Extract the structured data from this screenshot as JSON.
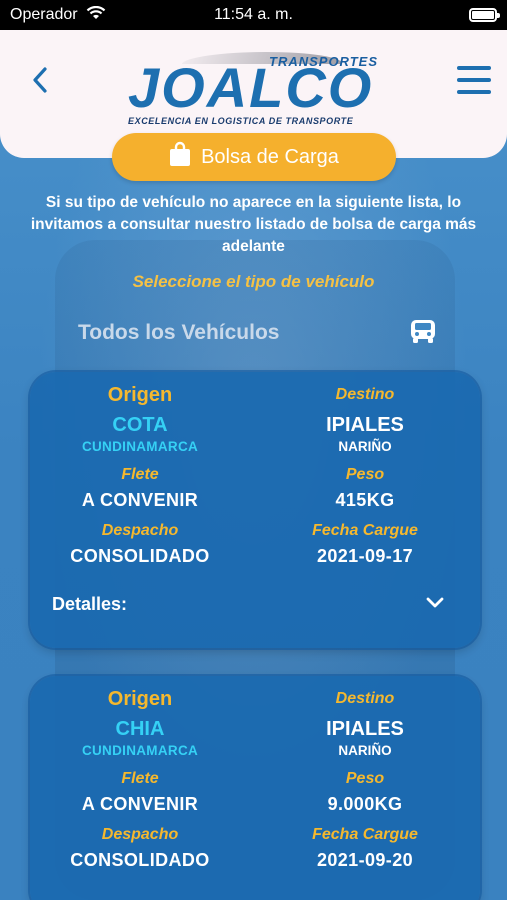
{
  "status_bar": {
    "carrier": "Operador",
    "time": "11:54 a. m."
  },
  "header": {
    "logo": {
      "top": "TRANSPORTES",
      "main": "JOALCO",
      "subtitle": "EXCELENCIA EN LOGISTICA DE TRANSPORTE"
    }
  },
  "bolsa_button": {
    "label": "Bolsa de Carga"
  },
  "intro_text": "Si su tipo de vehículo no aparece en la siguiente lista, lo invitamos a consultar nuestro listado de bolsa de carga más adelante",
  "select_label": "Seleccione el tipo de vehículo",
  "vehicle_select": {
    "value": "Todos los Vehículos"
  },
  "labels": {
    "origen": "Origen",
    "destino": "Destino",
    "flete": "Flete",
    "peso": "Peso",
    "despacho": "Despacho",
    "fecha_cargue": "Fecha Cargue",
    "detalles": "Detalles:"
  },
  "cards": [
    {
      "origen_ciudad": "COTA",
      "origen_depto": "CUNDINAMARCA",
      "destino_ciudad": "IPIALES",
      "destino_depto": "NARIÑO",
      "flete": "A CONVENIR",
      "peso": "415KG",
      "despacho": "CONSOLIDADO",
      "fecha_cargue": "2021-09-17"
    },
    {
      "origen_ciudad": "CHIA",
      "origen_depto": "CUNDINAMARCA",
      "destino_ciudad": "IPIALES",
      "destino_depto": "NARIÑO",
      "flete": "A CONVENIR",
      "peso": "9.000KG",
      "despacho": "CONSOLIDADO",
      "fecha_cargue": "2021-09-20"
    }
  ],
  "colors": {
    "background": "#3f88c4",
    "accent_yellow": "#f5b02d",
    "card": "#1a69b0",
    "cyan": "#35d1f5",
    "brand_blue": "#1d6fb0"
  },
  "icons": {
    "back": "chevron-left-icon",
    "menu": "hamburger-menu-icon",
    "bag": "shopping-bag-icon",
    "truck": "truck-icon",
    "expand": "chevron-down-icon",
    "wifi": "wifi-icon",
    "battery": "battery-icon"
  }
}
